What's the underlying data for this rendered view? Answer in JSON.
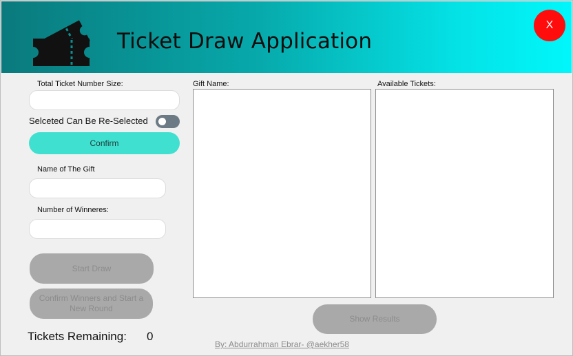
{
  "header": {
    "title": "Ticket Draw Application",
    "close_label": "X",
    "logo_icon": "ticket-icon"
  },
  "left_panel": {
    "total_ticket_label": "Total Ticket Number Size:",
    "total_ticket_value": "",
    "reselect_label": "Selceted Can Be Re-Selected",
    "reselect_enabled": false,
    "confirm_label": "Confirm",
    "gift_name_label": "Name of The Gift",
    "gift_name_value": "",
    "winners_label": "Number of Winneres:",
    "winners_value": "",
    "start_draw_label": "Start Draw",
    "confirm_winners_label": "Confirm Winners and Start a New Round",
    "tickets_remaining_label": "Tickets Remaining:",
    "tickets_remaining_value": "0"
  },
  "lists": {
    "gift_name_header": "Gift Name:",
    "available_tickets_header": "Available Tickets:",
    "gift_items": [],
    "ticket_items": []
  },
  "footer": {
    "show_results_label": "Show Results",
    "credit": "By: Abdurrahman Ebrar- @aekher58"
  },
  "colors": {
    "header_gradient_start": "#0a7a7d",
    "header_gradient_end": "#00f7fb",
    "close_button": "#ff0d0d",
    "confirm_button": "#40e0d0",
    "disabled_button": "#a9a9a9",
    "toggle_off": "#6c7a86"
  }
}
